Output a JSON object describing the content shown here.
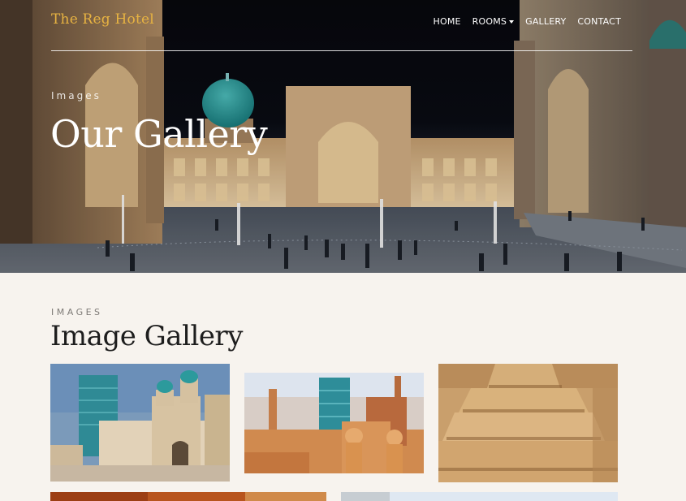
{
  "site": {
    "brand": "The Reg Hotel"
  },
  "nav": {
    "items": [
      {
        "label": "HOME"
      },
      {
        "label": "ROOMS",
        "has_dropdown": true
      },
      {
        "label": "GALLERY"
      },
      {
        "label": "CONTACT"
      }
    ]
  },
  "hero": {
    "eyebrow": "Images",
    "title": "Our Gallery"
  },
  "gallery": {
    "eyebrow": "IMAGES",
    "title": "Image Gallery",
    "images": [
      {
        "subject": "Khiva minaret and fortress walls"
      },
      {
        "subject": "Khiva old city with blue minaret"
      },
      {
        "subject": "Ancient clay fortress walls"
      },
      {
        "subject": "Warm lit interior"
      },
      {
        "subject": "Pale sky cityscape"
      }
    ]
  },
  "colors": {
    "brand": "#e7b342",
    "page_background": "#f7f3ee",
    "title_text": "#1d1d1d"
  }
}
